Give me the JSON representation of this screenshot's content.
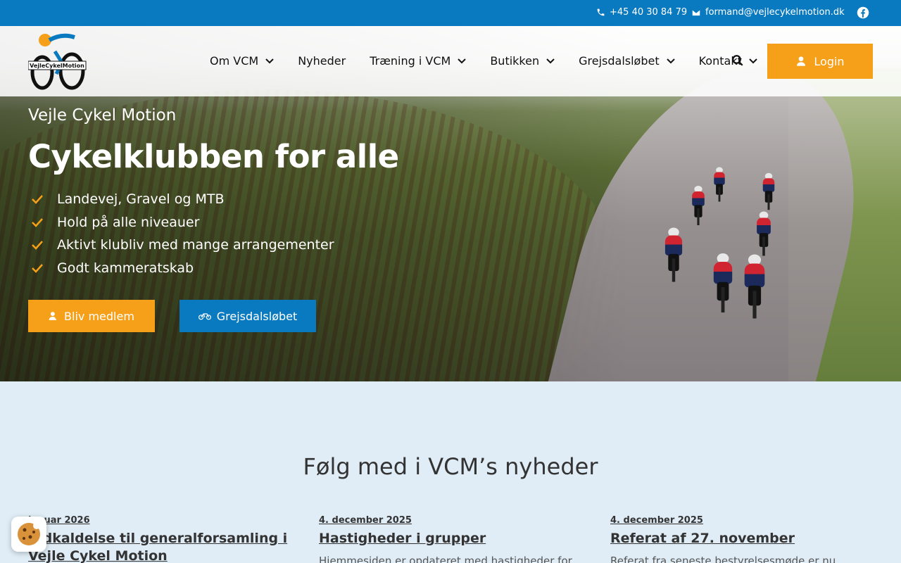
{
  "topbar": {
    "phone": "+45 40 30 84 79",
    "email": "formand@vejlecykelmotion.dk",
    "bg_color": "#0a7ac0"
  },
  "header": {
    "logo_text": "VejleCykelMotion",
    "nav": [
      {
        "label": "Om VCM",
        "has_dropdown": true
      },
      {
        "label": "Nyheder",
        "has_dropdown": false
      },
      {
        "label": "Træning i VCM",
        "has_dropdown": true
      },
      {
        "label": "Butikken",
        "has_dropdown": true
      },
      {
        "label": "Grejsdalsløbet",
        "has_dropdown": true
      },
      {
        "label": "Kontakt",
        "has_dropdown": true
      }
    ],
    "search_icon": "search-icon",
    "login_label": "Login",
    "accent_color": "#f6a01a"
  },
  "hero": {
    "kicker": "Vejle Cykel Motion",
    "headline": "Cykelklubben for alle",
    "bullets": [
      "Landevej, Gravel og MTB",
      "Hold på alle niveauer",
      "Aktivt klubliv med mange arrangementer",
      "Godt kammeratskab"
    ],
    "cta_member": "Bliv medlem",
    "cta_race": "Grejsdalsløbet"
  },
  "news": {
    "title": "Følg med i VCM’s nyheder",
    "cards": [
      {
        "date": "januar 2026",
        "title": "Indkaldelse til generalforsamling i Vejle Cykel Motion",
        "excerpt": ""
      },
      {
        "date": "4. december 2025",
        "title": "Hastigheder i grupper",
        "excerpt": "Hjemmesiden er opdateret med hastigheder for"
      },
      {
        "date": "4. december 2025",
        "title": "Referat af 27. november",
        "excerpt": "Referat fra seneste bestyrelsesmøde er nu"
      }
    ]
  },
  "cookie": {
    "icon": "cookie-icon"
  }
}
